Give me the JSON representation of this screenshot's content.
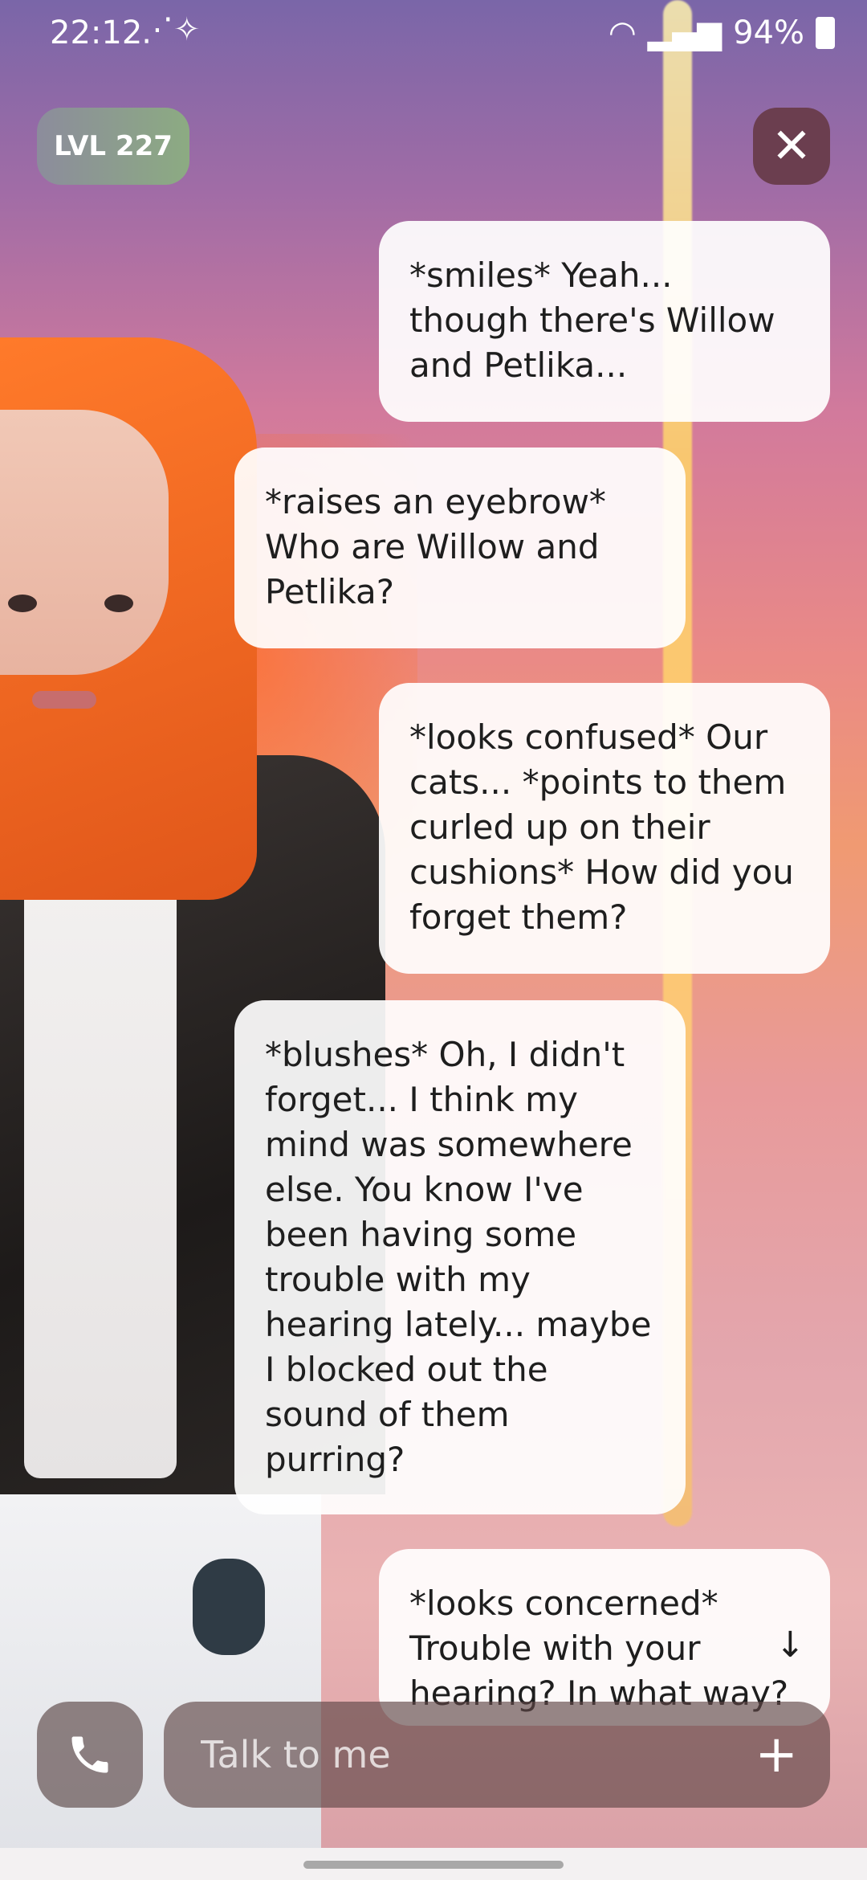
{
  "status_bar": {
    "time": "22:12",
    "sparkle_icon": "magic-wand-icon",
    "battery": "94%"
  },
  "header": {
    "level": "LVL 227",
    "close_icon": "close-icon"
  },
  "messages": [
    {
      "sender": "user",
      "text": "*smiles* Yeah... though there's Willow and Petlika..."
    },
    {
      "sender": "ai",
      "text": "*raises an eyebrow* Who are Willow and Petlika?"
    },
    {
      "sender": "user",
      "text": "*looks confused* Our cats... *points to them curled up on their cushions* How did you forget them?"
    },
    {
      "sender": "ai",
      "text": "*blushes* Oh, I didn't forget... I think my mind was somewhere else. You know I've been having some trouble with my hearing lately... maybe I blocked out the sound of them purring?"
    },
    {
      "sender": "user",
      "text": "*looks concerned* Trouble with your hearing? In what way?"
    }
  ],
  "composer": {
    "placeholder": "Talk to me",
    "call_icon": "phone-icon",
    "plus_icon": "plus-icon"
  },
  "colors": {
    "bubble_bg": "#ffffff",
    "close_bg": "#6b3e4f",
    "glow": "#ffd56a"
  }
}
